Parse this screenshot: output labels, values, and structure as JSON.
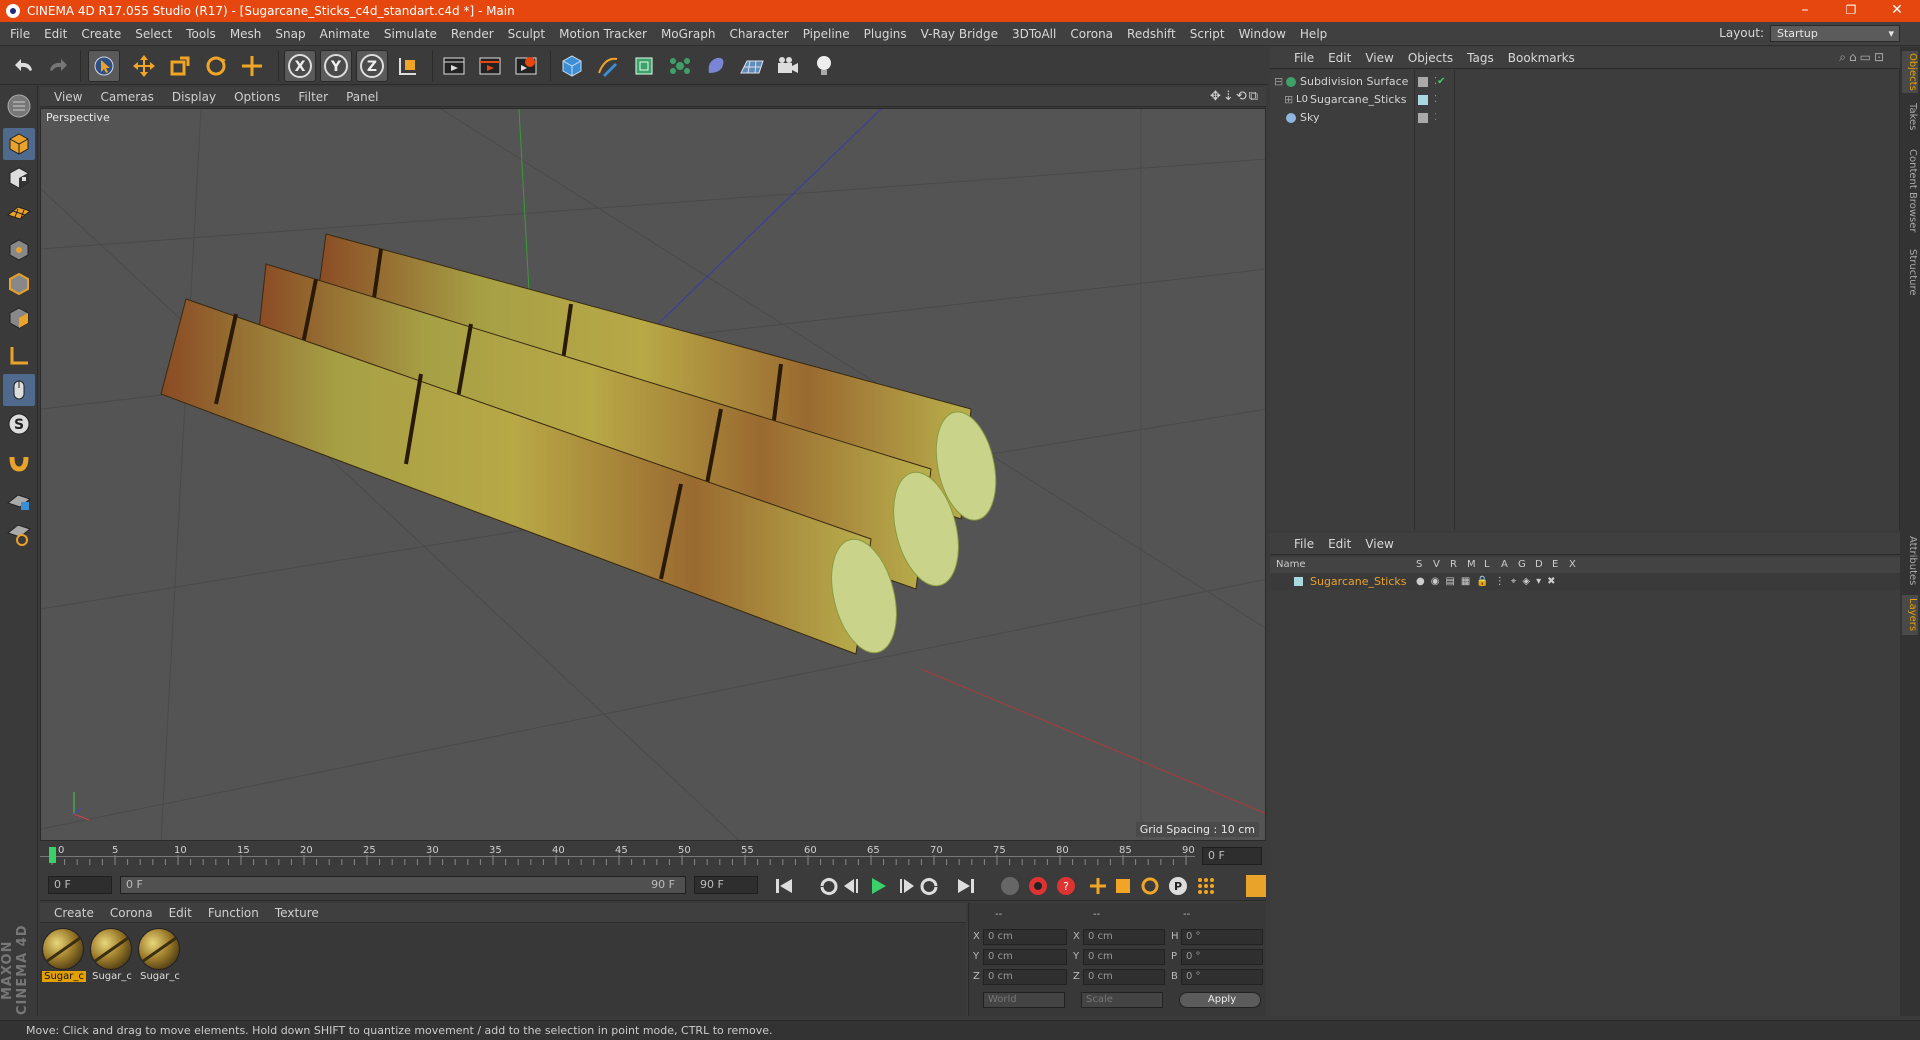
{
  "window": {
    "title": "CINEMA 4D R17.055 Studio (R17) - [Sugarcane_Sticks_c4d_standart.c4d *] - Main",
    "minimize": "–",
    "maximize": "❐",
    "close": "✕"
  },
  "menubar": {
    "items": [
      "File",
      "Edit",
      "Create",
      "Select",
      "Tools",
      "Mesh",
      "Snap",
      "Animate",
      "Simulate",
      "Render",
      "Sculpt",
      "Motion Tracker",
      "MoGraph",
      "Character",
      "Pipeline",
      "Plugins",
      "V-Ray Bridge",
      "3DToAll",
      "Corona",
      "Redshift",
      "Script",
      "Window",
      "Help"
    ],
    "layout_label": "Layout:",
    "layout_value": "Startup"
  },
  "toolbar": {
    "axis_x": "X",
    "axis_y": "Y",
    "axis_z": "Z"
  },
  "viewport": {
    "menu": [
      "View",
      "Cameras",
      "Display",
      "Options",
      "Filter",
      "Panel"
    ],
    "label": "Perspective",
    "grid_spacing": "Grid Spacing : 10 cm"
  },
  "timeline": {
    "ticks": [
      "0",
      "5",
      "10",
      "15",
      "20",
      "25",
      "30",
      "35",
      "40",
      "45",
      "50",
      "55",
      "60",
      "65",
      "70",
      "75",
      "80",
      "85",
      "90"
    ],
    "frame_field": "0 F",
    "start_field": "0 F",
    "slider_start": "0 F",
    "slider_end": "90 F",
    "end_field": "90 F"
  },
  "materials": {
    "menu": [
      "Create",
      "Corona",
      "Edit",
      "Function",
      "Texture"
    ],
    "items": [
      {
        "label": "Sugar_c",
        "selected": true
      },
      {
        "label": "Sugar_c",
        "selected": false
      },
      {
        "label": "Sugar_c",
        "selected": false
      }
    ]
  },
  "coordinates": {
    "headers": [
      "--",
      "--",
      "--"
    ],
    "rows": [
      {
        "a": "X",
        "av": "0 cm",
        "b": "X",
        "bv": "0 cm",
        "c": "H",
        "cv": "0 °"
      },
      {
        "a": "Y",
        "av": "0 cm",
        "b": "Y",
        "bv": "0 cm",
        "c": "P",
        "cv": "0 °"
      },
      {
        "a": "Z",
        "av": "0 cm",
        "b": "Z",
        "bv": "0 cm",
        "c": "B",
        "cv": "0 °"
      }
    ],
    "mode1": "World",
    "mode2": "Scale",
    "apply": "Apply"
  },
  "objects": {
    "menu": [
      "File",
      "Edit",
      "View",
      "Objects",
      "Tags",
      "Bookmarks"
    ],
    "tree": [
      {
        "name": "Subdivision Surface",
        "indent": 0,
        "expander": "⊟"
      },
      {
        "name": "Sugarcane_Sticks",
        "indent": 1,
        "expander": "⊞"
      },
      {
        "name": "Sky",
        "indent": 0,
        "expander": ""
      }
    ]
  },
  "layers": {
    "menu": [
      "File",
      "Edit",
      "View"
    ],
    "header_name": "Name",
    "header_cols": [
      "S",
      "V",
      "R",
      "M",
      "L",
      "A",
      "G",
      "D",
      "E",
      "X"
    ],
    "row_name": "Sugarcane_Sticks"
  },
  "sidetabs": {
    "top": [
      "Objects",
      "Takes",
      "Content Browser",
      "Structure"
    ],
    "bottom": [
      "Attributes",
      "Layers"
    ]
  },
  "branding": "MAXON CINEMA 4D",
  "status": "Move: Click and drag to move elements. Hold down SHIFT to quantize movement / add to the selection in point mode, CTRL to remove."
}
